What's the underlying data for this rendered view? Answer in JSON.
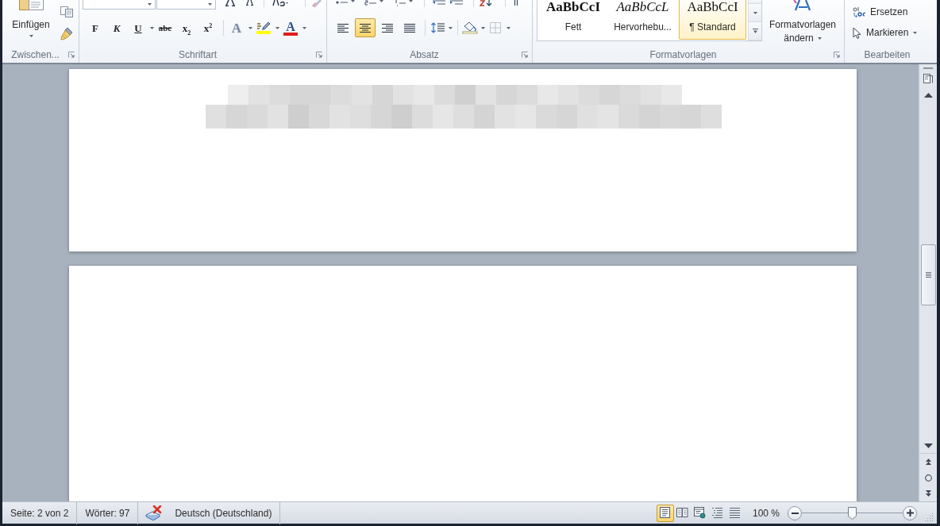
{
  "ribbon": {
    "clipboard": {
      "title": "Zwischen...",
      "paste_label": "Einfügen"
    },
    "font": {
      "title": "Schriftart",
      "format_buttons": [
        {
          "label": "F",
          "kind": "bold"
        },
        {
          "label": "K",
          "kind": "italic"
        },
        {
          "label": "U",
          "kind": "underline"
        },
        {
          "label": "abc",
          "kind": "strikethrough"
        },
        {
          "label": "x$_{2}$",
          "kind": "subscript"
        },
        {
          "label": "x$^{2}$",
          "kind": "superscript"
        }
      ],
      "text_effects": {
        "label": "A"
      },
      "highlight": {
        "color": "#ffff00"
      },
      "font_color": {
        "label": "A",
        "color": "#e01b1b"
      }
    },
    "paragraph": {
      "title": "Absatz",
      "alignments": [
        {
          "kind": "left",
          "selected": false
        },
        {
          "kind": "center",
          "selected": true
        },
        {
          "kind": "right",
          "selected": false
        },
        {
          "kind": "justify",
          "selected": false
        }
      ]
    },
    "styles": {
      "title": "Formatvorlagen",
      "gallery": [
        {
          "sample": "AaBbCcI",
          "name": "Fett",
          "kind": "bold",
          "selected": false
        },
        {
          "sample": "AaBbCcL",
          "name": "Hervorhebu...",
          "kind": "italic",
          "selected": false
        },
        {
          "sample": "AaBbCcI",
          "name": "¶ Standard",
          "kind": "normal",
          "selected": true
        }
      ],
      "change_styles": {
        "label_lines": [
          "Formatvorlagen",
          "ändern"
        ]
      }
    },
    "editing": {
      "title": "Bearbeiten",
      "items": [
        {
          "label": "Ersetzen",
          "kind": "replace"
        },
        {
          "label": "Markieren",
          "kind": "select"
        }
      ]
    }
  },
  "status_bar": {
    "page": "Seite: 2 von 2",
    "words": "Wörter: 97",
    "language": "Deutsch (Deutschland)",
    "views": [
      {
        "kind": "print_layout",
        "selected": true
      },
      {
        "kind": "full_screen_reading",
        "selected": false
      },
      {
        "kind": "web_layout",
        "selected": false
      },
      {
        "kind": "outline",
        "selected": false
      },
      {
        "kind": "draft",
        "selected": false
      }
    ],
    "zoom": "100 %",
    "zoom_slider": {
      "level": 0.5
    }
  }
}
